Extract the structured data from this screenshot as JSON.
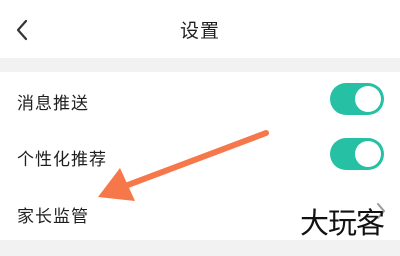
{
  "header": {
    "title": "设置",
    "back_icon": "chevron-left-icon"
  },
  "settings": {
    "items": [
      {
        "label": "消息推送",
        "control": "toggle",
        "enabled": true
      },
      {
        "label": "个性化推荐",
        "control": "toggle",
        "enabled": true
      },
      {
        "label": "家长监管",
        "control": "chevron",
        "icon": "chevron-right-icon"
      }
    ]
  },
  "overlay": {
    "watermark_text": "大玩客",
    "arrow_icon": "annotation-arrow-icon"
  },
  "colors": {
    "toggle_on": "#26c1a4",
    "arrow": "#f5774a",
    "header_bg": "#ffffff",
    "page_bg": "#f2f2f2"
  }
}
